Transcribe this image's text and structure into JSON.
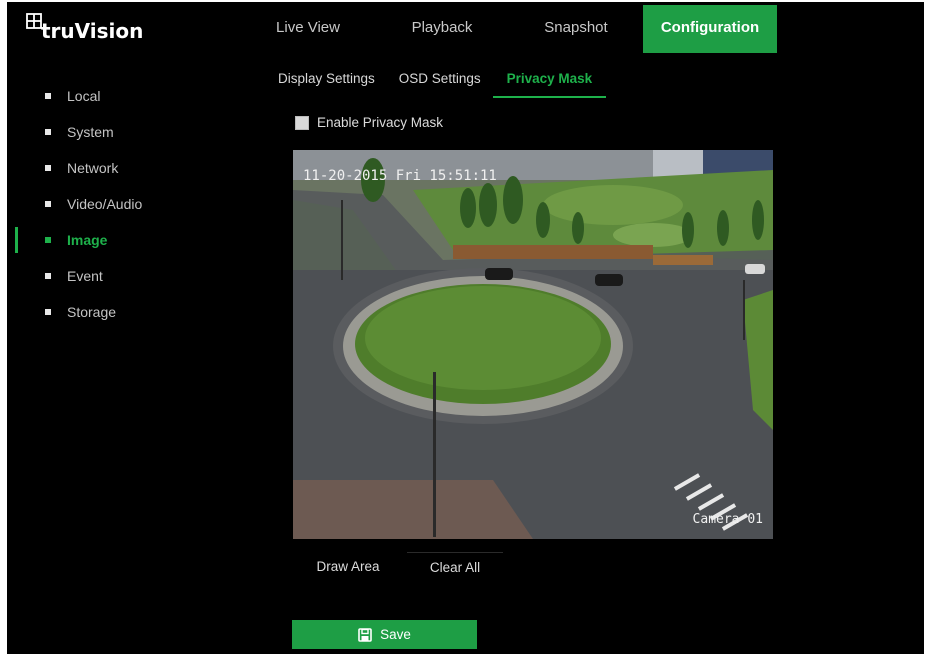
{
  "brand": {
    "logo_text": "truVision",
    "logo_icon": "camera-grid-icon"
  },
  "topnav": {
    "tabs": [
      {
        "label": "Live View",
        "active": false
      },
      {
        "label": "Playback",
        "active": false
      },
      {
        "label": "Snapshot",
        "active": false
      },
      {
        "label": "Configuration",
        "active": true
      }
    ]
  },
  "sidebar": {
    "items": [
      {
        "label": "Local",
        "active": false
      },
      {
        "label": "System",
        "active": false
      },
      {
        "label": "Network",
        "active": false
      },
      {
        "label": "Video/Audio",
        "active": false
      },
      {
        "label": "Image",
        "active": true
      },
      {
        "label": "Event",
        "active": false
      },
      {
        "label": "Storage",
        "active": false
      }
    ]
  },
  "subtabs": {
    "items": [
      {
        "label": "Display Settings",
        "active": false
      },
      {
        "label": "OSD Settings",
        "active": false
      },
      {
        "label": "Privacy Mask",
        "active": true
      }
    ]
  },
  "privacy": {
    "enable_label": "Enable Privacy Mask",
    "enabled": false
  },
  "video": {
    "osd_time": "11-20-2015  Fri 15:51:11",
    "osd_camera": "Camera 01"
  },
  "actions": {
    "draw_area": "Draw Area",
    "clear_all": "Clear All"
  },
  "save": {
    "label": "Save",
    "icon": "floppy-disk-icon"
  },
  "colors": {
    "accent": "#1e9e45",
    "active_text": "#1eb14b",
    "background": "#000000"
  }
}
